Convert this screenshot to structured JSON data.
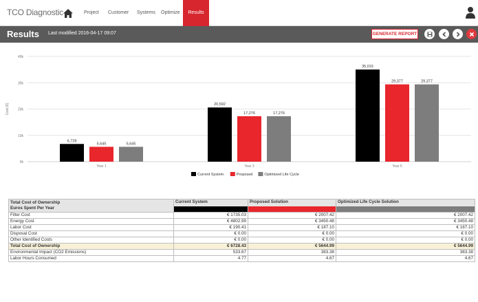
{
  "app": {
    "title": "TCO Diagnostic",
    "nav": [
      "Project",
      "Customer",
      "Systems",
      "Optimize",
      "Results"
    ],
    "active_nav": "Results"
  },
  "titlebar": {
    "title": "Results",
    "modified": "Last modified 2016-04-17 09:07",
    "generate_report": "GENERATE REPORT"
  },
  "colors": {
    "accent": "#d7262e",
    "current": "#000000",
    "proposed": "#e8262c",
    "optimized": "#7d7d7d"
  },
  "chart_data": {
    "type": "bar",
    "categories": [
      "Year 1",
      "Year 3",
      "Year 5"
    ],
    "series": [
      {
        "name": "Current System",
        "values": [
          6728,
          20592,
          35015
        ]
      },
      {
        "name": "Proposed",
        "values": [
          5645,
          17276,
          29377
        ]
      },
      {
        "name": "Optimized Life Cycle",
        "values": [
          5645,
          17276,
          29377
        ]
      }
    ],
    "data_labels": [
      [
        "6,728",
        "5,645",
        "5,645"
      ],
      [
        "20,592",
        "17,276",
        "17,276"
      ],
      [
        "35,015",
        "29,377",
        "29,377"
      ]
    ],
    "yticks": [
      "0k",
      "10k",
      "20k",
      "30k",
      "40k"
    ],
    "ylim": [
      0,
      40000
    ],
    "ylabel": "Cost (€)",
    "xlabel": "",
    "legend_position": "bottom-center",
    "grid": true
  },
  "table": {
    "header_line1": "Total Cost of Ownership",
    "header_line2": "Euros Spent Per Year",
    "columns": [
      "Current System",
      "Proposed Solution",
      "Optimized Life Cycle Solution"
    ],
    "rows": [
      {
        "label": "Filter Cost",
        "values": [
          "€ 1735.03",
          "€ 2007.42",
          "€ 2007.42"
        ]
      },
      {
        "label": "Energy Cost",
        "values": [
          "€ 4802.99",
          "€ 3450.48",
          "€ 3450.48"
        ]
      },
      {
        "label": "Labor Cost",
        "values": [
          "€ 190.41",
          "€ 187.10",
          "€ 187.10"
        ]
      },
      {
        "label": "Disposal Cost",
        "values": [
          "€ 0.00",
          "€ 0.00",
          "€ 0.00"
        ]
      },
      {
        "label": "Other Identified Costs",
        "values": [
          "€ 0.00",
          "€ 0.00",
          "€ 0.00"
        ]
      }
    ],
    "total": {
      "label": "Total Cost of Ownership",
      "values": [
        "€ 6728.43",
        "€ 5644.99",
        "€ 5644.99"
      ]
    },
    "extra_rows": [
      {
        "label": "Environmental Impact (CO2 Emissions)",
        "values": [
          "533.67",
          "383.38",
          "383.38"
        ]
      },
      {
        "label": "Labor Hours Consumed",
        "values": [
          "4.77",
          "4.67",
          "4.67"
        ]
      }
    ]
  }
}
